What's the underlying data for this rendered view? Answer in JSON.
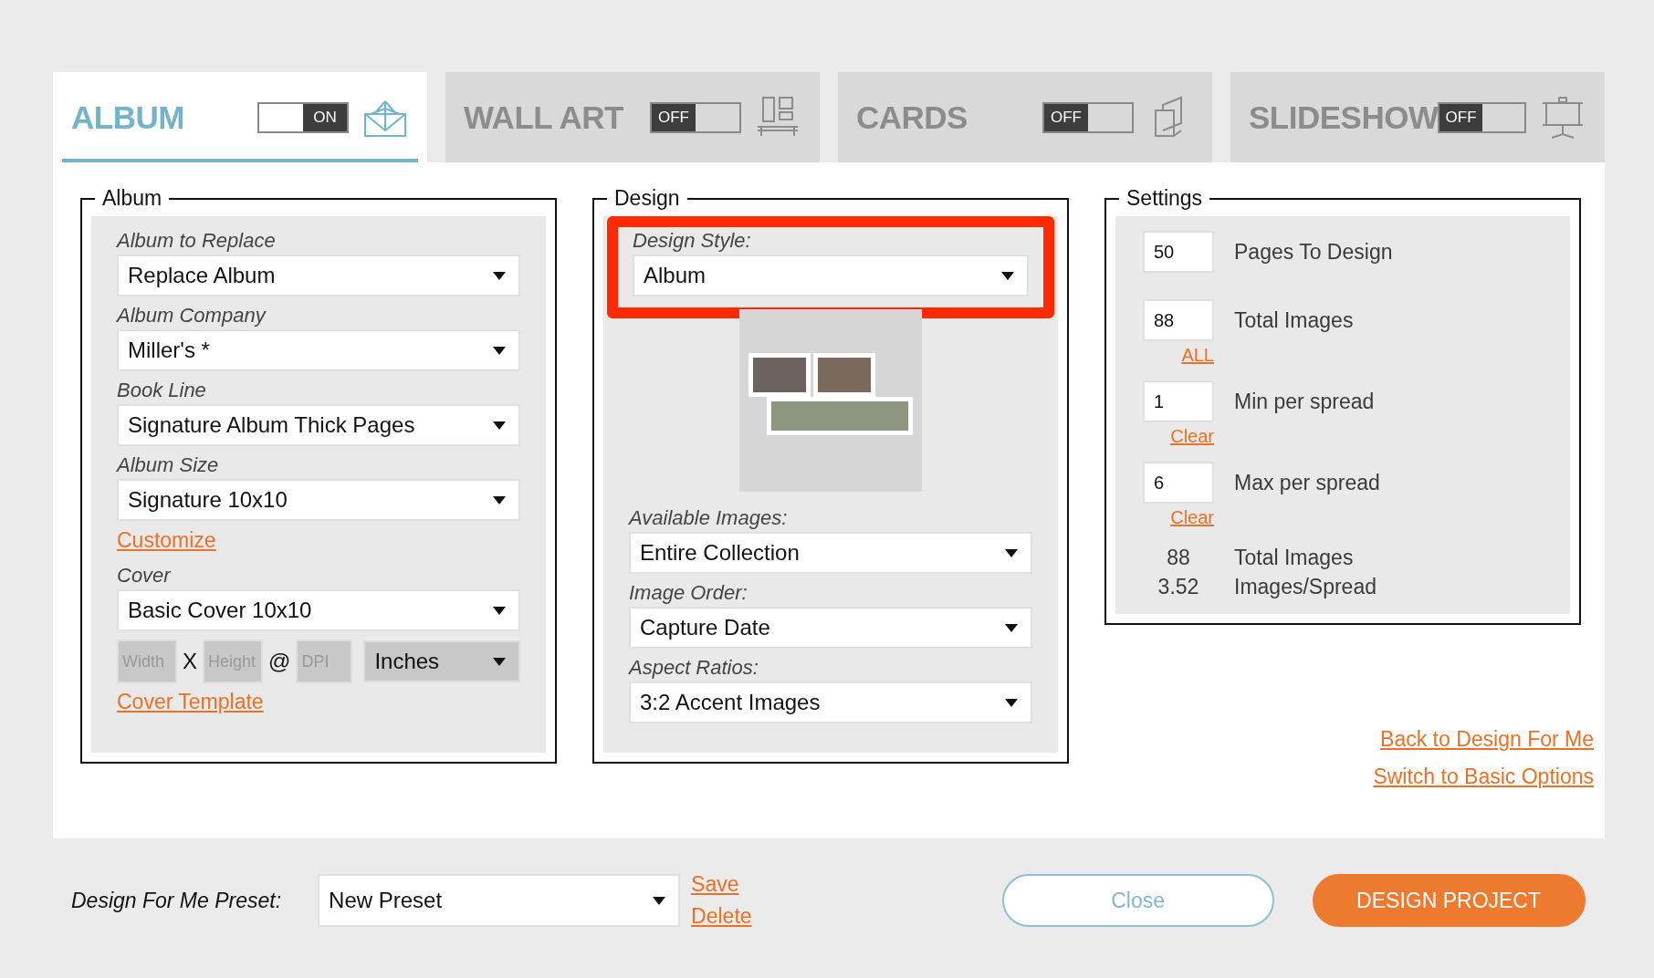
{
  "tabs": [
    {
      "label": "ALBUM",
      "selected": true,
      "kind": "album",
      "toggle": {
        "on": true,
        "text": "ON"
      }
    },
    {
      "label": "WALL ART",
      "selected": false,
      "kind": "wall_art",
      "toggle": {
        "on": false,
        "text": "OFF"
      }
    },
    {
      "label": "CARDS",
      "selected": false,
      "kind": "cards",
      "toggle": {
        "on": false,
        "text": "OFF"
      }
    },
    {
      "label": "SLIDESHOW",
      "selected": false,
      "kind": "slideshow",
      "toggle": {
        "on": false,
        "text": "OFF"
      }
    }
  ],
  "album": {
    "legend": "Album",
    "items": [
      {
        "kind": "select",
        "label": "Album to Replace",
        "value": "Replace Album"
      },
      {
        "kind": "select",
        "label": "Album Company",
        "value": "Miller's *"
      },
      {
        "kind": "select",
        "label": "Book Line",
        "value": "Signature Album Thick Pages"
      },
      {
        "kind": "select",
        "label": "Album Size",
        "value": "Signature 10x10"
      },
      {
        "kind": "link",
        "text": "Customize"
      },
      {
        "kind": "select",
        "label": "Cover",
        "value": "Basic Cover 10x10"
      },
      {
        "kind": "dimensions",
        "width_placeholder": "Width",
        "times": "X",
        "height_placeholder": "Height",
        "at": "@",
        "dpi_placeholder": "DPI",
        "unit": "Inches"
      },
      {
        "kind": "link",
        "text": "Cover Template"
      }
    ]
  },
  "design": {
    "legend": "Design",
    "items": [
      {
        "kind": "select",
        "label": "Design Style:",
        "value": "Album",
        "highlighted": true
      },
      {
        "kind": "preview"
      },
      {
        "kind": "select",
        "label": "Available Images:",
        "value": "Entire Collection",
        "highlighted": false
      },
      {
        "kind": "select",
        "label": "Image Order:",
        "value": "Capture Date",
        "highlighted": false
      },
      {
        "kind": "select",
        "label": "Aspect Ratios:",
        "value": "3:2 Accent Images",
        "highlighted": false
      }
    ]
  },
  "settings": {
    "legend": "Settings",
    "rows": [
      {
        "value": "50",
        "label": "Pages To Design"
      },
      {
        "value": "88",
        "label": "Total Images",
        "link": "ALL"
      },
      {
        "value": "1",
        "label": "Min per spread",
        "link": "Clear"
      },
      {
        "value": "6",
        "label": "Max per spread",
        "link": "Clear"
      }
    ],
    "summary": [
      {
        "value": "88",
        "label": "Total Images"
      },
      {
        "value": "3.52",
        "label": "Images/Spread"
      }
    ]
  },
  "side_links": [
    "Back to Design For Me",
    "Switch to Basic Options"
  ],
  "footer": {
    "preset_label": "Design For Me Preset:",
    "preset_value": "New Preset",
    "links": [
      "Save",
      "Delete"
    ],
    "close": "Close",
    "primary": "DESIGN PROJECT"
  }
}
